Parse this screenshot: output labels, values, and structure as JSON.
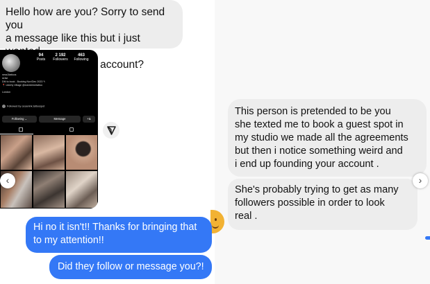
{
  "messages": {
    "m1": "Hello how are you?  Sorry to send you\na message like this but i just wanted\nto ask if this is your account?",
    "m2": "This person is pretended to be you\nshe texted me to book a guest spot in\nmy studio we made all the agreements\nbut then i notice something weird and\ni end up founding your account .",
    "m3": "She's probably trying to get as many\nfollowers possible in order to look\nreal .",
    "m4": "Hi no it isn't!! Thanks for bringing that\nto my attention!!",
    "m5": "Did they follow or message you?!"
  },
  "instagram_screenshot": {
    "stats": [
      {
        "value": "94",
        "label": "Posts"
      },
      {
        "value": "2 192",
        "label": "Followers"
      },
      {
        "value": "463",
        "label": "Following"
      }
    ],
    "bio": "ness3tattoos\nArtist\nDM to book - Booking Nov/Dec 2023 ✎\n📍 Liberty Village @ecinkbirnetattoo\n\nLondon",
    "followed_by": "Followed by oceanink.tattoospot",
    "following_button": "Following ⌄",
    "message_button": "Message",
    "add_button": "+&"
  },
  "icons": {
    "share": "send-icon",
    "prev": "chevron-left-icon",
    "next": "chevron-right-icon",
    "emoji": "emoji-icon"
  },
  "colors": {
    "incoming_bubble": "#ededed",
    "outgoing_bubble": "#3478f6",
    "outgoing_text": "#ffffff"
  }
}
